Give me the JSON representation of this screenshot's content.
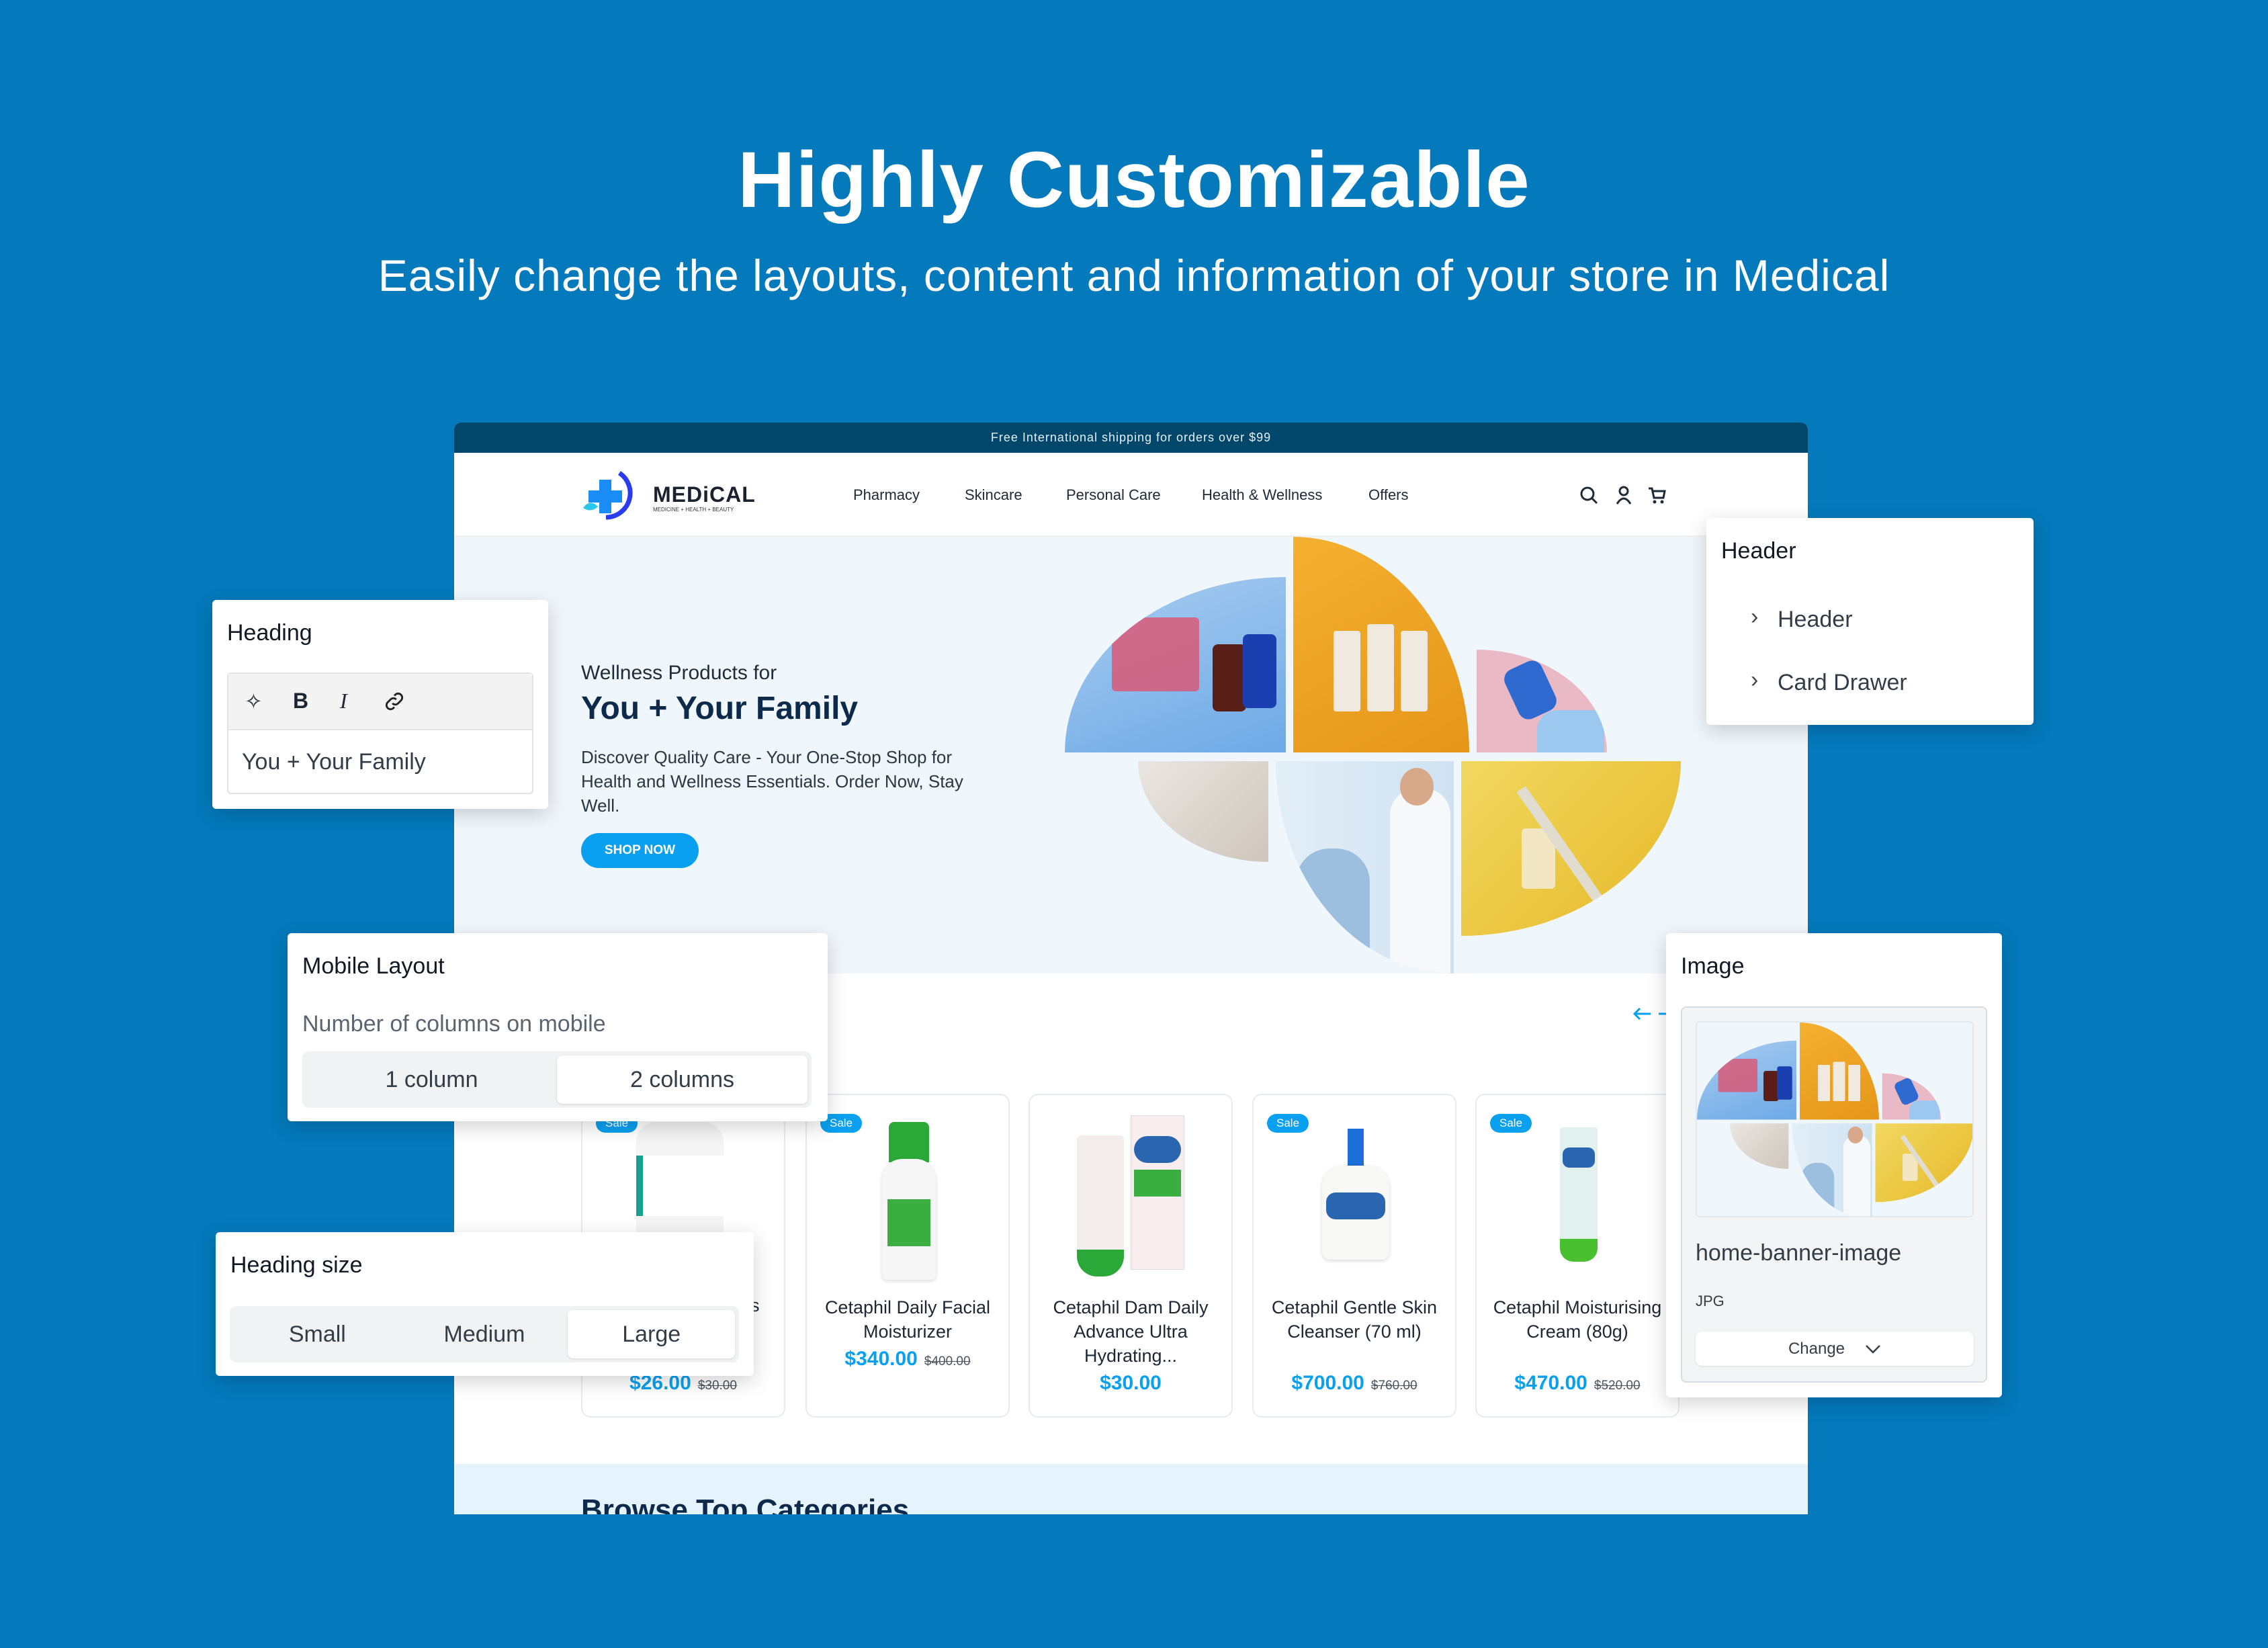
{
  "hero_banner": {
    "title": "Highly Customizable",
    "subtitle": "Easily change the layouts, content and information of your store in Medical"
  },
  "store": {
    "announcement": "Free International shipping for orders over $99",
    "logo": {
      "name": "MEDiCAL",
      "tagline": "MEDICINE + HEALTH + BEAUTY"
    },
    "nav": [
      "Pharmacy",
      "Skincare",
      "Personal Care",
      "Health & Wellness",
      "Offers"
    ],
    "icons": [
      "search-icon",
      "account-icon",
      "cart-icon"
    ],
    "hero": {
      "eyebrow": "Wellness Products for",
      "heading": "You + Your Family",
      "text": "Discover Quality Care - Your One-Stop Shop for Health and Wellness Essentials. Order Now, Stay Well.",
      "button": "SHOP NOW"
    },
    "products": [
      {
        "name_fragment": "s",
        "price": "$26.00",
        "compare": "$30.00",
        "sale": true,
        "sale_label": "Sale"
      },
      {
        "name": "Cetaphil Daily Facial Moisturizer",
        "price": "$340.00",
        "compare": "$400.00",
        "sale": true,
        "sale_label": "Sale"
      },
      {
        "name": "Cetaphil Dam Daily Advance Ultra Hydrating...",
        "price": "$30.00",
        "compare": "",
        "sale": false
      },
      {
        "name": "Cetaphil Gentle Skin Cleanser (70 ml)",
        "price": "$700.00",
        "compare": "$760.00",
        "sale": true,
        "sale_label": "Sale"
      },
      {
        "name": "Cetaphil Moisturising Cream (80g)",
        "price": "$470.00",
        "compare": "$520.00",
        "sale": true,
        "sale_label": "Sale"
      }
    ],
    "section_title": "Browse Top Categories",
    "accent": "#0aa0f0"
  },
  "heading_panel": {
    "title": "Heading",
    "value": "You + Your Family",
    "tools": [
      "magic-icon",
      "bold-icon",
      "italic-icon",
      "link-icon"
    ]
  },
  "header_panel": {
    "title": "Header",
    "items": [
      "Header",
      "Card Drawer"
    ]
  },
  "mobile_panel": {
    "title": "Mobile Layout",
    "label": "Number of columns on mobile",
    "options": [
      "1 column",
      "2 columns"
    ],
    "selected": "2 columns"
  },
  "size_panel": {
    "title": "Heading size",
    "options": [
      "Small",
      "Medium",
      "Large"
    ],
    "selected": "Large"
  },
  "image_panel": {
    "title": "Image",
    "filename": "home-banner-image",
    "type": "JPG",
    "button": "Change"
  }
}
